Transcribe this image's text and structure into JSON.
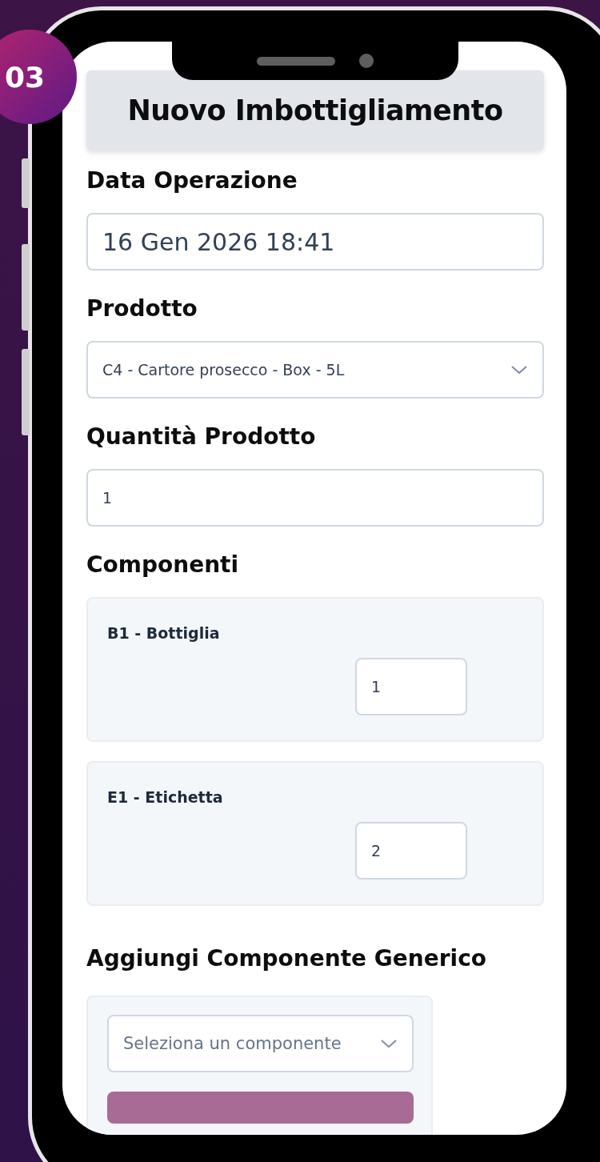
{
  "badge": "03",
  "title": "Nuovo Imbottigliamento",
  "fields": [
    {
      "kind": "datetime",
      "label": "Data Operazione",
      "value": "16 Gen 2026 18:41"
    },
    {
      "kind": "select",
      "label": "Prodotto",
      "value": "C4 - Cartore prosecco - Box - 5L"
    },
    {
      "kind": "number",
      "label": "Quantità Prodotto",
      "value": "1"
    }
  ],
  "components": {
    "heading": "Componenti",
    "items": [
      {
        "name": "B1 - Bottiglia",
        "quantity": "1"
      },
      {
        "name": "E1 - Etichetta",
        "quantity": "2"
      }
    ]
  },
  "generic": {
    "heading": "Aggiungi Componente Generico",
    "select": {
      "placeholder": "Seleziona un componente"
    }
  }
}
